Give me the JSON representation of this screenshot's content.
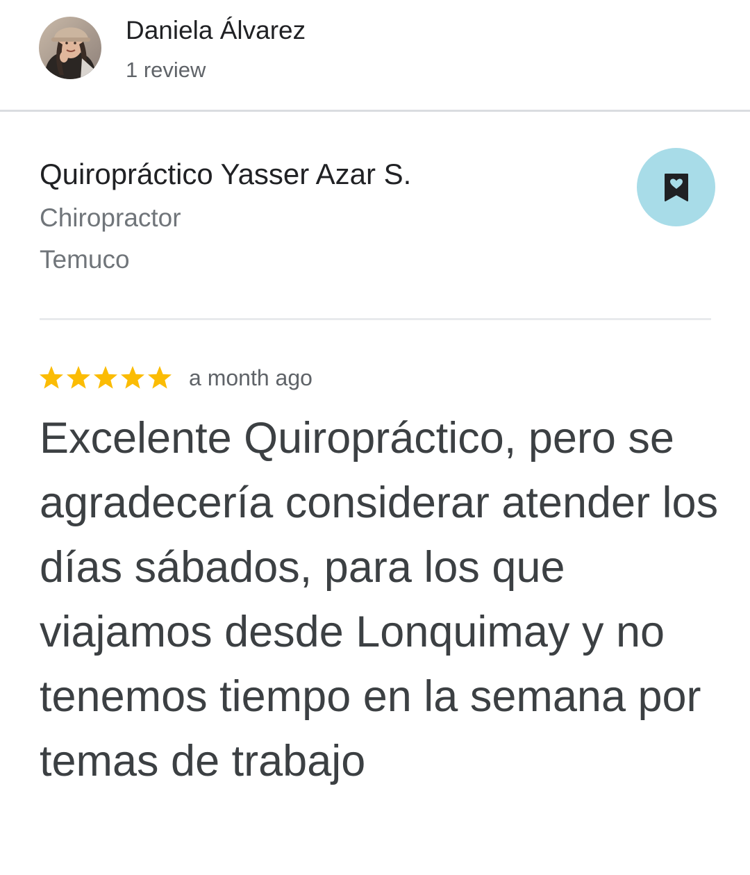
{
  "reviewer": {
    "name": "Daniela Álvarez",
    "review_count": "1 review",
    "avatar_icon": "user-photo"
  },
  "place": {
    "name": "Quiropráctico Yasser Azar S.",
    "category": "Chiropractor",
    "city": "Temuco",
    "save_icon": "bookmark-heart-icon"
  },
  "review": {
    "rating": 5,
    "max_rating": 5,
    "time": "a month ago",
    "text": "Excelente Quiropráctico, pero se agradecería considerar atender los días sábados, para los que viajamos desde Lonquimay y no tenemos tiempo en la semana por temas de trabajo"
  },
  "colors": {
    "star": "#FBBC04",
    "save_button_bg": "#A8DCE8",
    "divider": "#DADCE0",
    "secondary_text": "#70757A"
  }
}
